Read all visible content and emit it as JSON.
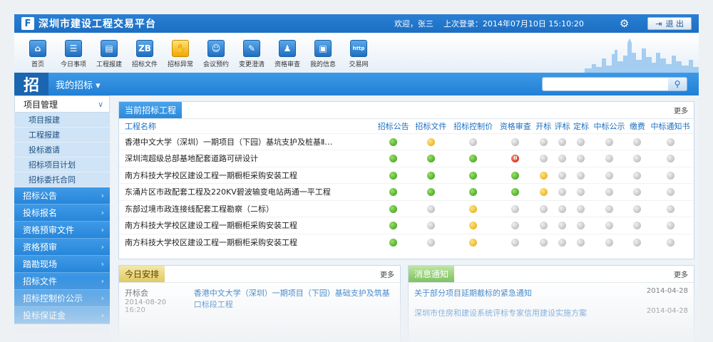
{
  "header": {
    "logo_glyph": "F",
    "title": "深圳市建设工程交易平台",
    "welcome": "欢迎，张三",
    "last_login": "上次登录：2014年07月10日 15:10:20",
    "logout_label": "退 出"
  },
  "toolbar": [
    {
      "label": "首页",
      "glyph": "⌂",
      "icon": "home-icon"
    },
    {
      "label": "今日事项",
      "glyph": "☰",
      "icon": "calendar-icon"
    },
    {
      "label": "工程报建",
      "glyph": "▤",
      "icon": "building-icon"
    },
    {
      "label": "招标文件",
      "glyph": "ZB",
      "icon": "document-icon"
    },
    {
      "label": "招标异常",
      "glyph": "✋",
      "icon": "hand-icon",
      "yellow": true
    },
    {
      "label": "会议预约",
      "glyph": "☺",
      "icon": "meeting-icon"
    },
    {
      "label": "变更澄清",
      "glyph": "✎",
      "icon": "edit-icon"
    },
    {
      "label": "资格审查",
      "glyph": "♟",
      "icon": "person-icon"
    },
    {
      "label": "我的信息",
      "glyph": "▣",
      "icon": "profile-icon"
    },
    {
      "label": "交易网",
      "glyph": "http",
      "icon": "web-icon"
    }
  ],
  "bluebar": {
    "badge": "招",
    "label": "我的招标",
    "search_placeholder": ""
  },
  "sidebar": {
    "head": "项目管理",
    "subitems": [
      "项目报建",
      "工程报建",
      "投标邀请",
      "招标项目计划",
      "招标委托合同"
    ],
    "items": [
      "招标公告",
      "投标报名",
      "资格预审文件",
      "资格预审",
      "踏勘现场",
      "招标文件",
      "招标控制价公示",
      "投标保证金"
    ]
  },
  "bid_panel": {
    "title": "当前招标工程",
    "more": "更多",
    "columns": [
      "工程名称",
      "招标公告",
      "招标文件",
      "招标控制价",
      "资格审查",
      "开标",
      "评标",
      "定标",
      "中标公示",
      "缴费",
      "中标通知书"
    ],
    "rows": [
      {
        "name": "香港中文大学（深圳）一期项目（下园）基坑支护及桩基Ⅱ…",
        "status": [
          "g",
          "y",
          "n",
          "n",
          "n",
          "n",
          "n",
          "n",
          "n",
          "n"
        ]
      },
      {
        "name": "深圳湾超级总部基地配套道路可研设计",
        "status": [
          "g",
          "g",
          "g",
          "r",
          "n",
          "n",
          "n",
          "n",
          "n",
          "n"
        ]
      },
      {
        "name": "南方科技大学校区建设工程一期橱柜采购安装工程",
        "status": [
          "g",
          "g",
          "g",
          "g",
          "y",
          "n",
          "n",
          "n",
          "n",
          "n"
        ]
      },
      {
        "name": "东涌片区市政配套工程及220KV碧波输变电站两通一平工程",
        "status": [
          "g",
          "g",
          "g",
          "g",
          "y",
          "n",
          "n",
          "n",
          "n",
          "n"
        ]
      },
      {
        "name": "东部过境市政连接线配套工程勘察（二标）",
        "status": [
          "g",
          "n",
          "y",
          "n",
          "n",
          "n",
          "n",
          "n",
          "n",
          "n"
        ]
      },
      {
        "name": "南方科技大学校区建设工程一期橱柜采购安装工程",
        "status": [
          "g",
          "n",
          "y",
          "n",
          "n",
          "n",
          "n",
          "n",
          "n",
          "n"
        ]
      },
      {
        "name": "南方科技大学校区建设工程一期橱柜采购安装工程",
        "status": [
          "g",
          "n",
          "y",
          "n",
          "n",
          "n",
          "n",
          "n",
          "n",
          "n"
        ]
      }
    ]
  },
  "today_panel": {
    "title": "今日安排",
    "more": "更多",
    "rows": [
      {
        "type": "开标会",
        "date": "2014-08-20 16:20",
        "desc": "香港中文大学（深圳）一期项目（下园）基础支护及筑基口标段工程"
      }
    ]
  },
  "news_panel": {
    "title": "消息通知",
    "more": "更多",
    "rows": [
      {
        "text": "关于部分项目延期截标的紧急通知",
        "date": "2014-04-28"
      },
      {
        "text": "深圳市住房和建设系统评标专家信用建设实施方案",
        "date": "2014-04-28"
      }
    ]
  }
}
